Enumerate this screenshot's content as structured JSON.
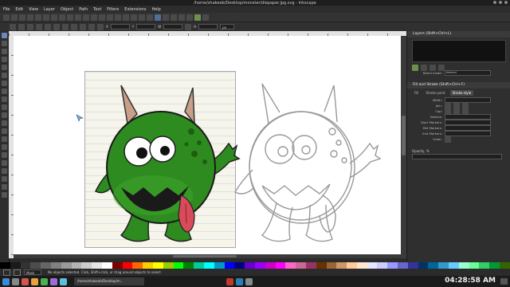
{
  "window": {
    "title": "/home/shakeeb/Desktop/monster/diepaper.jpg.svg - Inkscape"
  },
  "menubar": {
    "items": [
      "File",
      "Edit",
      "View",
      "Layer",
      "Object",
      "Path",
      "Text",
      "Filters",
      "Extensions",
      "Help"
    ]
  },
  "controls": {
    "x_label": "X",
    "y_label": "Y",
    "w_label": "W",
    "h_label": "H",
    "unit": "px"
  },
  "panels": {
    "layers_title": "Layers (Shift+Ctrl+L)",
    "fill_stroke_title": "Fill and Stroke (Shift+Ctrl+F)",
    "tabs": [
      "Fill",
      "Stroke paint",
      "Stroke style"
    ],
    "active_tab": "Stroke style",
    "blend_label": "Blend mode:",
    "blend_value": "Normal",
    "opacity_label": "Opacity, %",
    "stroke_rows": [
      "Width:",
      "Join:",
      "Cap:",
      "Dashes:",
      "Start Markers:",
      "Mid Markers:",
      "End Markers:",
      "Order:"
    ]
  },
  "status": {
    "layer": "Mask",
    "message": "No objects selected. Click, Shift+click, or drag around objects to select."
  },
  "taskbar": {
    "task_label": "/home/shakeeb/Desktop/m...",
    "clock": "04:28:58 AM"
  },
  "colors": {
    "monster_green": "#2e8b1f",
    "tongue_red": "#d94a5a",
    "horn": "#c8a08a",
    "sketch_gray": "#999999",
    "paper": "#f7f4ea"
  },
  "palette": [
    "#000000",
    "#1a1a1a",
    "#333333",
    "#4d4d4d",
    "#666666",
    "#808080",
    "#999999",
    "#b3b3b3",
    "#cccccc",
    "#e6e6e6",
    "#ffffff",
    "#800000",
    "#ff0000",
    "#ff6600",
    "#ffcc00",
    "#ffff00",
    "#99cc00",
    "#00ff00",
    "#008000",
    "#00cc99",
    "#00ffff",
    "#0099cc",
    "#0000ff",
    "#000080",
    "#6600cc",
    "#9900ff",
    "#cc00cc",
    "#ff00ff",
    "#ff66cc",
    "#cc6699",
    "#993366",
    "#663300",
    "#996633",
    "#cc9966",
    "#ffcc99",
    "#ffe6cc",
    "#e6e6ff",
    "#ccccff",
    "#9999ff",
    "#6666cc",
    "#333399",
    "#003366",
    "#006699",
    "#3399cc",
    "#66ccff",
    "#99ffcc",
    "#66ff99",
    "#33cc66",
    "#009933",
    "#336600"
  ]
}
